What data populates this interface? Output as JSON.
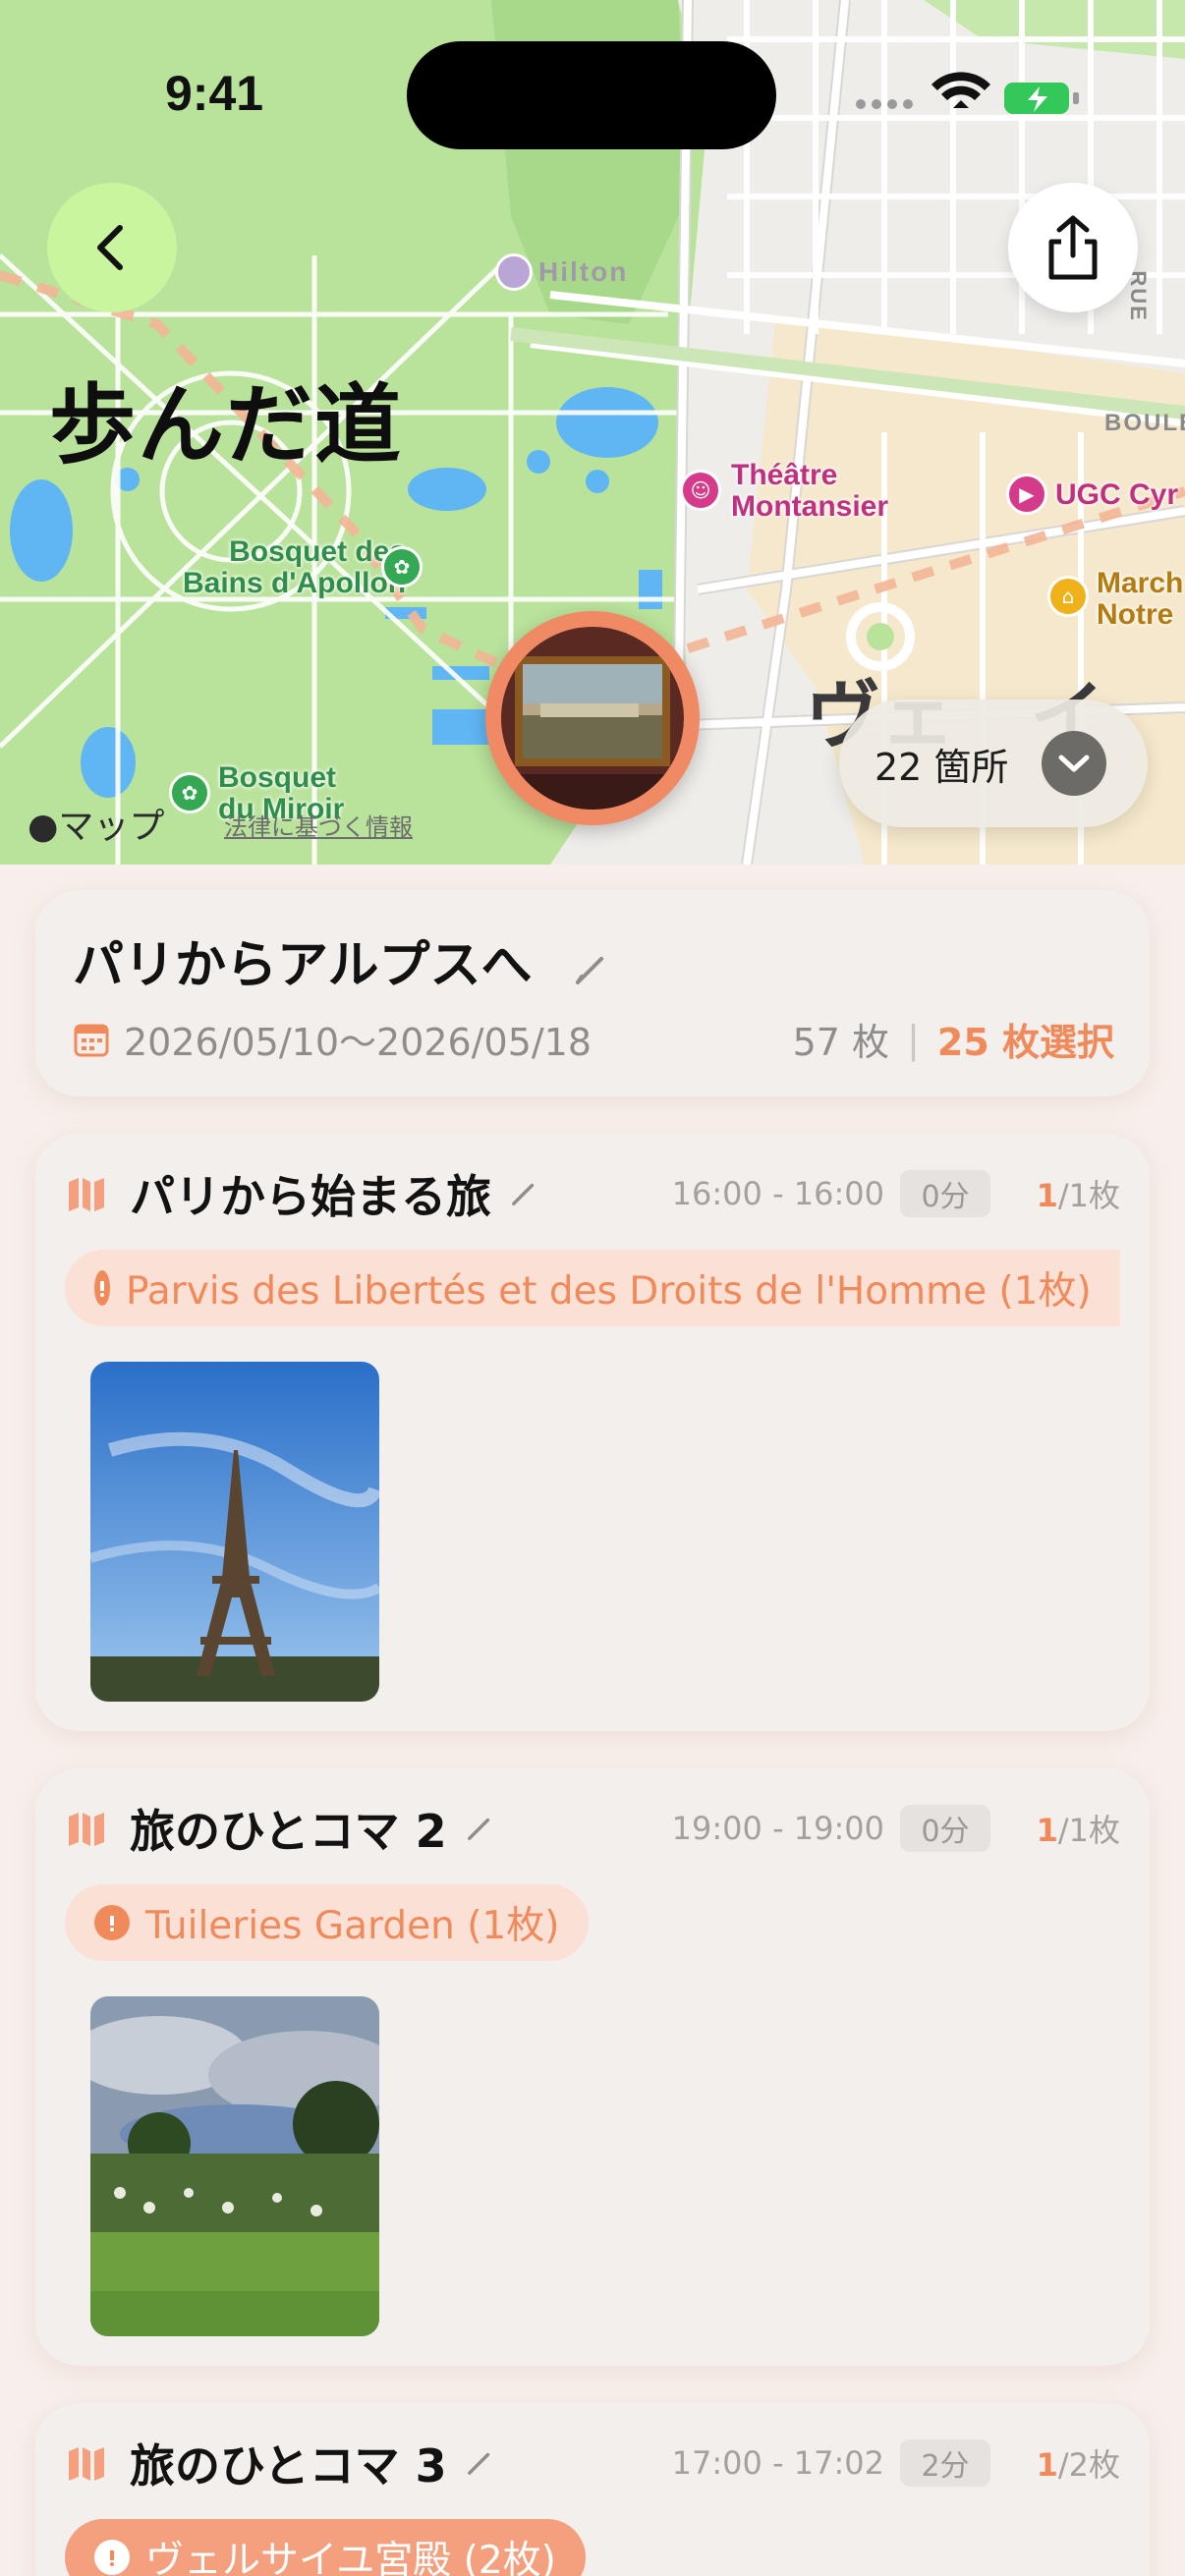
{
  "status_bar": {
    "time": "9:41"
  },
  "map": {
    "title": "歩んだ道",
    "labels": {
      "hilton": "Hilton",
      "bosquet_bains_1": "Bosquet des",
      "bosquet_bains_2": "Bains d'Apollon",
      "bosquet_miroir_1": "Bosquet",
      "bosquet_miroir_2": "du Miroir",
      "theatre_1": "Théâtre",
      "theatre_2": "Montansier",
      "ugc": "UGC Cyr",
      "marche_1": "March",
      "marche_2": "Notre",
      "boulevard": "BOULE",
      "rue": "RUE",
      "versailles_big": "ヴェ　イ"
    },
    "places_chip": "22 箇所",
    "attribution": "マップ",
    "legal": "法律に基づく情報"
  },
  "trip": {
    "title": "パリからアルプスへ",
    "dates": "2026/05/10〜2026/05/18",
    "total": "57 枚",
    "separator": "|",
    "selected": "25 枚選択"
  },
  "sections": [
    {
      "title": "パリから始まる旅",
      "time": "16:00 - 16:00",
      "duration": "0分",
      "selected": "1",
      "total": "/1枚",
      "location": "Parvis des Libertés et des Droits de l'Homme (1枚)"
    },
    {
      "title": "旅のひとコマ 2",
      "time": "19:00 - 19:00",
      "duration": "0分",
      "selected": "1",
      "total": "/1枚",
      "location": "Tuileries Garden (1枚)"
    },
    {
      "title": "旅のひとコマ 3",
      "time": "17:00 - 17:02",
      "duration": "2分",
      "selected": "1",
      "total": "/2枚",
      "location": "ヴェルサイユ宮殿 (2枚)"
    }
  ],
  "colors": {
    "accent": "#f08a5a",
    "back_button": "#c9f59e",
    "pin_ring": "#f08a64"
  }
}
